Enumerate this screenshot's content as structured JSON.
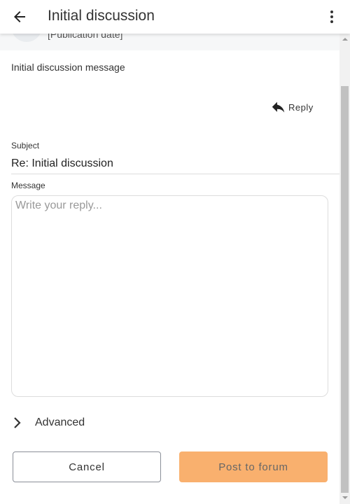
{
  "header": {
    "title": "Initial discussion",
    "back_icon": "arrow-left-icon",
    "menu_icon": "more-vertical-icon"
  },
  "post": {
    "publication_date": "[Publication date]",
    "message": "Initial discussion message",
    "reply_label": "Reply"
  },
  "form": {
    "subject_label": "Subject",
    "subject_value": "Re: Initial discussion",
    "message_label": "Message",
    "message_placeholder": "Write your reply...",
    "advanced_label": "Advanced",
    "cancel_label": "Cancel",
    "post_label": "Post to forum"
  },
  "colors": {
    "primary_button": "#f9b06e",
    "meta_background": "#f6f7f8"
  }
}
